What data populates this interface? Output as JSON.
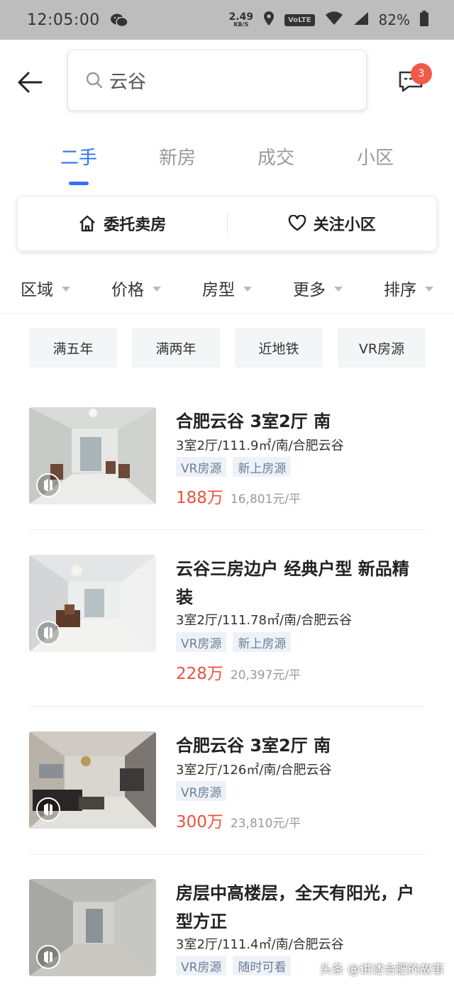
{
  "status_bar": {
    "time": "12:05:00",
    "net_speed_value": "2.49",
    "net_speed_unit": "KB/S",
    "volte": "VoLTE",
    "battery": "82%"
  },
  "header": {
    "search_text": "云谷",
    "message_badge": "3"
  },
  "tabs": [
    {
      "label": "二手"
    },
    {
      "label": "新房"
    },
    {
      "label": "成交"
    },
    {
      "label": "小区"
    }
  ],
  "actions": {
    "sell": "委托卖房",
    "follow": "关注小区"
  },
  "filters": [
    {
      "label": "区域"
    },
    {
      "label": "价格"
    },
    {
      "label": "房型"
    },
    {
      "label": "更多"
    },
    {
      "label": "排序"
    }
  ],
  "quick_tags": [
    {
      "label": "满五年"
    },
    {
      "label": "满两年"
    },
    {
      "label": "近地铁"
    },
    {
      "label": "VR房源"
    }
  ],
  "listings": [
    {
      "title": "合肥云谷 3室2厅 南",
      "info": "3室2厅/111.9㎡/南/合肥云谷",
      "tags": [
        "VR房源",
        "新上房源"
      ],
      "price": "188万",
      "unit_price": "16,801元/平"
    },
    {
      "title": "云谷三房边户  经典户型  新品精装",
      "info": "3室2厅/111.78㎡/南/合肥云谷",
      "tags": [
        "VR房源",
        "新上房源"
      ],
      "price": "228万",
      "unit_price": "20,397元/平"
    },
    {
      "title": "合肥云谷 3室2厅 南",
      "info": "3室2厅/126㎡/南/合肥云谷",
      "tags": [
        "VR房源"
      ],
      "price": "300万",
      "unit_price": "23,810元/平"
    },
    {
      "title": "房层中高楼层，全天有阳光，户型方正",
      "info": "3室2厅/111.4㎡/南/合肥云谷",
      "tags": [
        "VR房源",
        "随时可看"
      ],
      "price": "",
      "unit_price": ""
    }
  ],
  "watermark": "头条 @讲述合肥的故事",
  "colors": {
    "accent": "#3072f6",
    "price": "#e8533c",
    "badge": "#f15a4a"
  }
}
